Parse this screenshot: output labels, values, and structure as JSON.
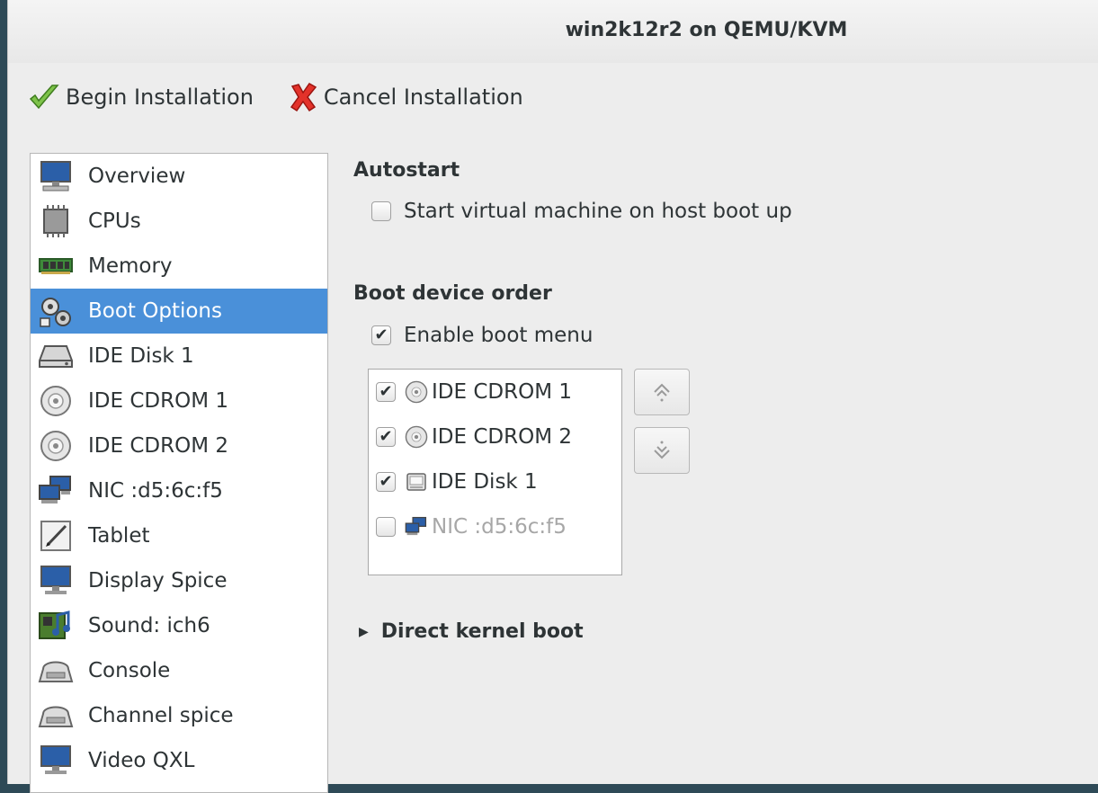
{
  "window": {
    "title": "win2k12r2 on QEMU/KVM"
  },
  "toolbar": {
    "begin_label": "Begin Installation",
    "cancel_label": "Cancel Installation"
  },
  "sidebar": {
    "items": [
      {
        "label": "Overview",
        "icon": "monitor-icon"
      },
      {
        "label": "CPUs",
        "icon": "cpu-icon"
      },
      {
        "label": "Memory",
        "icon": "memory-icon"
      },
      {
        "label": "Boot Options",
        "icon": "boot-options-icon",
        "selected": true
      },
      {
        "label": "IDE Disk 1",
        "icon": "disk-icon"
      },
      {
        "label": "IDE CDROM 1",
        "icon": "cdrom-icon"
      },
      {
        "label": "IDE CDROM 2",
        "icon": "cdrom-icon"
      },
      {
        "label": "NIC :d5:6c:f5",
        "icon": "network-icon"
      },
      {
        "label": "Tablet",
        "icon": "tablet-icon"
      },
      {
        "label": "Display Spice",
        "icon": "display-icon"
      },
      {
        "label": "Sound: ich6",
        "icon": "sound-icon"
      },
      {
        "label": "Console",
        "icon": "serial-icon"
      },
      {
        "label": "Channel spice",
        "icon": "serial-icon"
      },
      {
        "label": "Video QXL",
        "icon": "display-icon"
      }
    ]
  },
  "autostart": {
    "heading": "Autostart",
    "option_label": "Start virtual machine on host boot up",
    "checked": false
  },
  "boot_order": {
    "heading": "Boot device order",
    "enable_menu_label": "Enable boot menu",
    "enable_menu_checked": true,
    "devices": [
      {
        "label": "IDE CDROM 1",
        "icon": "cdrom-icon",
        "checked": true
      },
      {
        "label": "IDE CDROM 2",
        "icon": "cdrom-icon",
        "checked": true
      },
      {
        "label": "IDE Disk 1",
        "icon": "disk-icon",
        "checked": true
      },
      {
        "label": "NIC :d5:6c:f5",
        "icon": "network-icon",
        "checked": false
      }
    ],
    "move_up_icon": "move-up-icon",
    "move_down_icon": "move-down-icon"
  },
  "direct_kernel_boot": {
    "label": "Direct kernel boot",
    "expanded": false
  },
  "colors": {
    "selection": "#4a90d9",
    "window_bg": "#ededed",
    "text": "#2e3436"
  }
}
